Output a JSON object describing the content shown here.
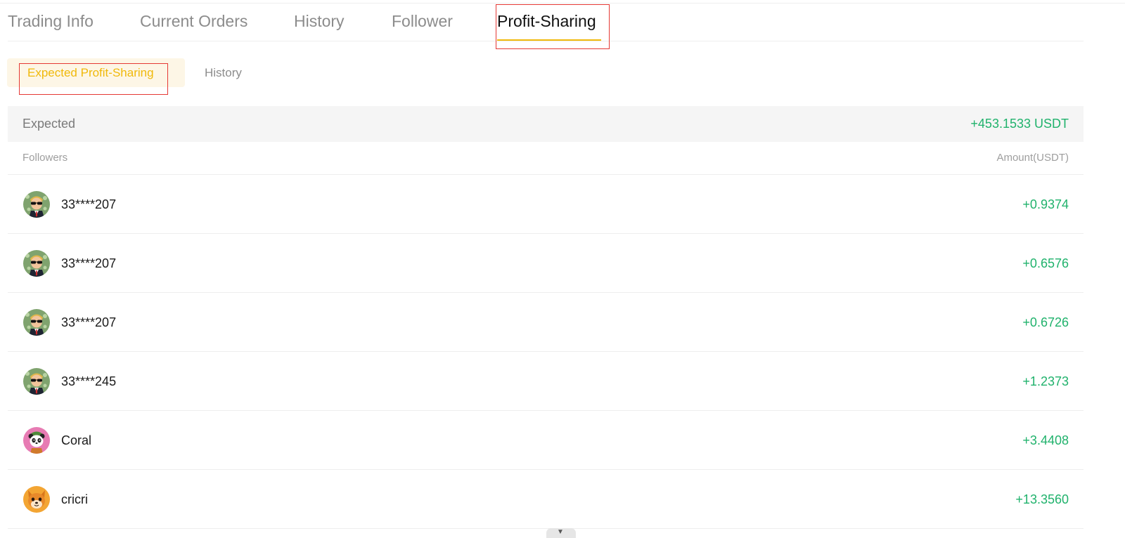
{
  "tabs": [
    {
      "label": "Trading Info"
    },
    {
      "label": "Current Orders"
    },
    {
      "label": "History"
    },
    {
      "label": "Follower"
    },
    {
      "label": "Profit-Sharing"
    }
  ],
  "active_tab": "Profit-Sharing",
  "subtabs": {
    "active": "Expected Profit-Sharing",
    "other": "History"
  },
  "expected": {
    "label": "Expected",
    "value": "+453.1533 USDT"
  },
  "table": {
    "col_followers": "Followers",
    "col_amount": "Amount(USDT)",
    "rows": [
      {
        "name": "33****207",
        "amount": "+0.9374",
        "avatar": "sunglasses-man-avatar"
      },
      {
        "name": "33****207",
        "amount": "+0.6576",
        "avatar": "sunglasses-man-avatar"
      },
      {
        "name": "33****207",
        "amount": "+0.6726",
        "avatar": "sunglasses-man-avatar"
      },
      {
        "name": "33****245",
        "amount": "+1.2373",
        "avatar": "sunglasses-man-avatar"
      },
      {
        "name": "Coral",
        "amount": "+3.4408",
        "avatar": "panda-avatar"
      },
      {
        "name": "cricri",
        "amount": "+13.3560",
        "avatar": "shiba-dog-avatar"
      }
    ]
  },
  "colors": {
    "accent": "#f0b90b",
    "positive": "#20b26c",
    "highlight_box": "#e53935"
  }
}
